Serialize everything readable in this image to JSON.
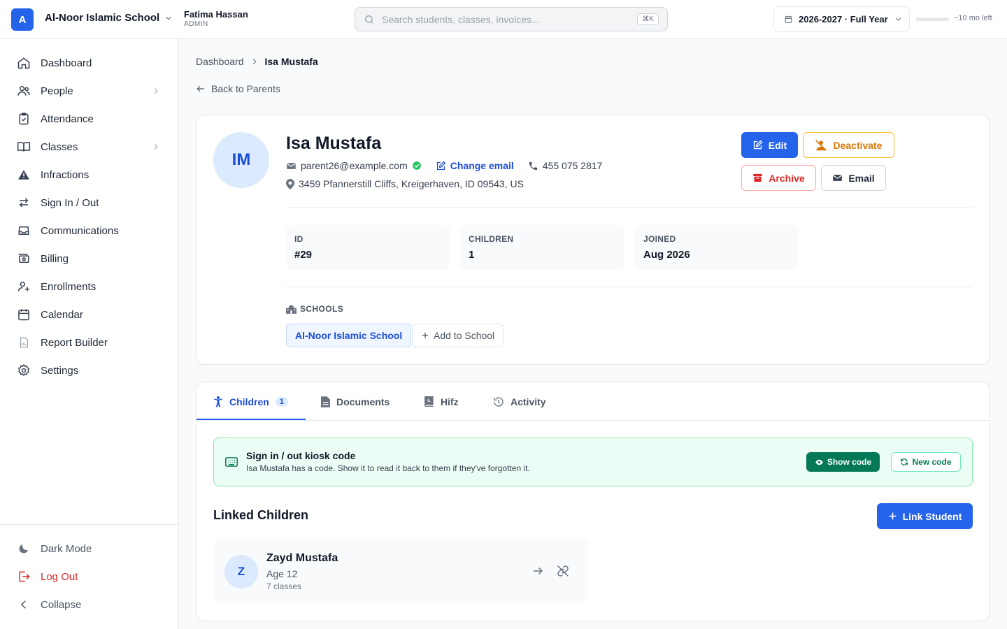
{
  "topbar": {
    "logo_letter": "A",
    "school_name": "Al-Noor Islamic School",
    "user_name": "Fatima Hassan",
    "user_role": "ADMIN",
    "search_placeholder": "Search students, classes, invoices...",
    "search_shortcut": "⌘K",
    "year_label": "2026-2027 · Full Year",
    "year_progress_fraction": 0.0,
    "year_remaining": "~10 mo left"
  },
  "sidebar": {
    "items": [
      {
        "label": "Dashboard",
        "icon": "home-icon"
      },
      {
        "label": "People",
        "icon": "users-icon",
        "has_submenu": true
      },
      {
        "label": "Attendance",
        "icon": "clipboard-check-icon"
      },
      {
        "label": "Classes",
        "icon": "book-open-icon",
        "has_submenu": true
      },
      {
        "label": "Infractions",
        "icon": "warning-icon"
      },
      {
        "label": "Sign In / Out",
        "icon": "arrows-swap-icon"
      },
      {
        "label": "Communications",
        "icon": "inbox-icon"
      },
      {
        "label": "Billing",
        "icon": "money-icon"
      },
      {
        "label": "Enrollments",
        "icon": "user-plus-icon"
      },
      {
        "label": "Calendar",
        "icon": "calendar-icon"
      },
      {
        "label": "Report Builder",
        "icon": "report-icon"
      },
      {
        "label": "Settings",
        "icon": "gear-icon"
      }
    ],
    "footer": {
      "dark_mode": "Dark Mode",
      "logout": "Log Out",
      "collapse": "Collapse"
    }
  },
  "breadcrumb": {
    "parent": "Dashboard",
    "current": "Isa Mustafa"
  },
  "back_link": "Back to Parents",
  "profile": {
    "initials": "IM",
    "name": "Isa Mustafa",
    "email": "parent26@example.com",
    "email_verified": true,
    "change_email": "Change email",
    "phone": "455 075 2817",
    "address": "3459 Pfannerstill Cliffs, Kreigerhaven, ID 09543, US",
    "actions": {
      "edit": "Edit",
      "deactivate": "Deactivate",
      "archive": "Archive",
      "email": "Email"
    },
    "stats": [
      {
        "label": "ID",
        "value": "#29"
      },
      {
        "label": "CHILDREN",
        "value": "1"
      },
      {
        "label": "JOINED",
        "value": "Aug 2026"
      }
    ],
    "schools_label": "SCHOOLS",
    "schools": [
      "Al-Noor Islamic School"
    ],
    "add_school": "Add to School"
  },
  "tabs": [
    {
      "label": "Children",
      "badge": "1",
      "active": true,
      "icon": "child-icon"
    },
    {
      "label": "Documents",
      "icon": "document-icon"
    },
    {
      "label": "Hifz",
      "icon": "quran-icon"
    },
    {
      "label": "Activity",
      "icon": "history-icon"
    }
  ],
  "kiosk": {
    "title": "Sign in / out kiosk code",
    "description": "Isa Mustafa has a code. Show it to read it back to them if they've forgotten it.",
    "show_code": "Show code",
    "new_code": "New code"
  },
  "linked_children": {
    "title": "Linked Children",
    "link_button": "Link Student",
    "children": [
      {
        "initial": "Z",
        "name": "Zayd Mustafa",
        "age": "Age 12",
        "classes": "7 classes"
      }
    ]
  },
  "colors": {
    "primary": "#2563eb",
    "warning": "#d97706",
    "danger": "#dc2626",
    "success": "#047857"
  }
}
